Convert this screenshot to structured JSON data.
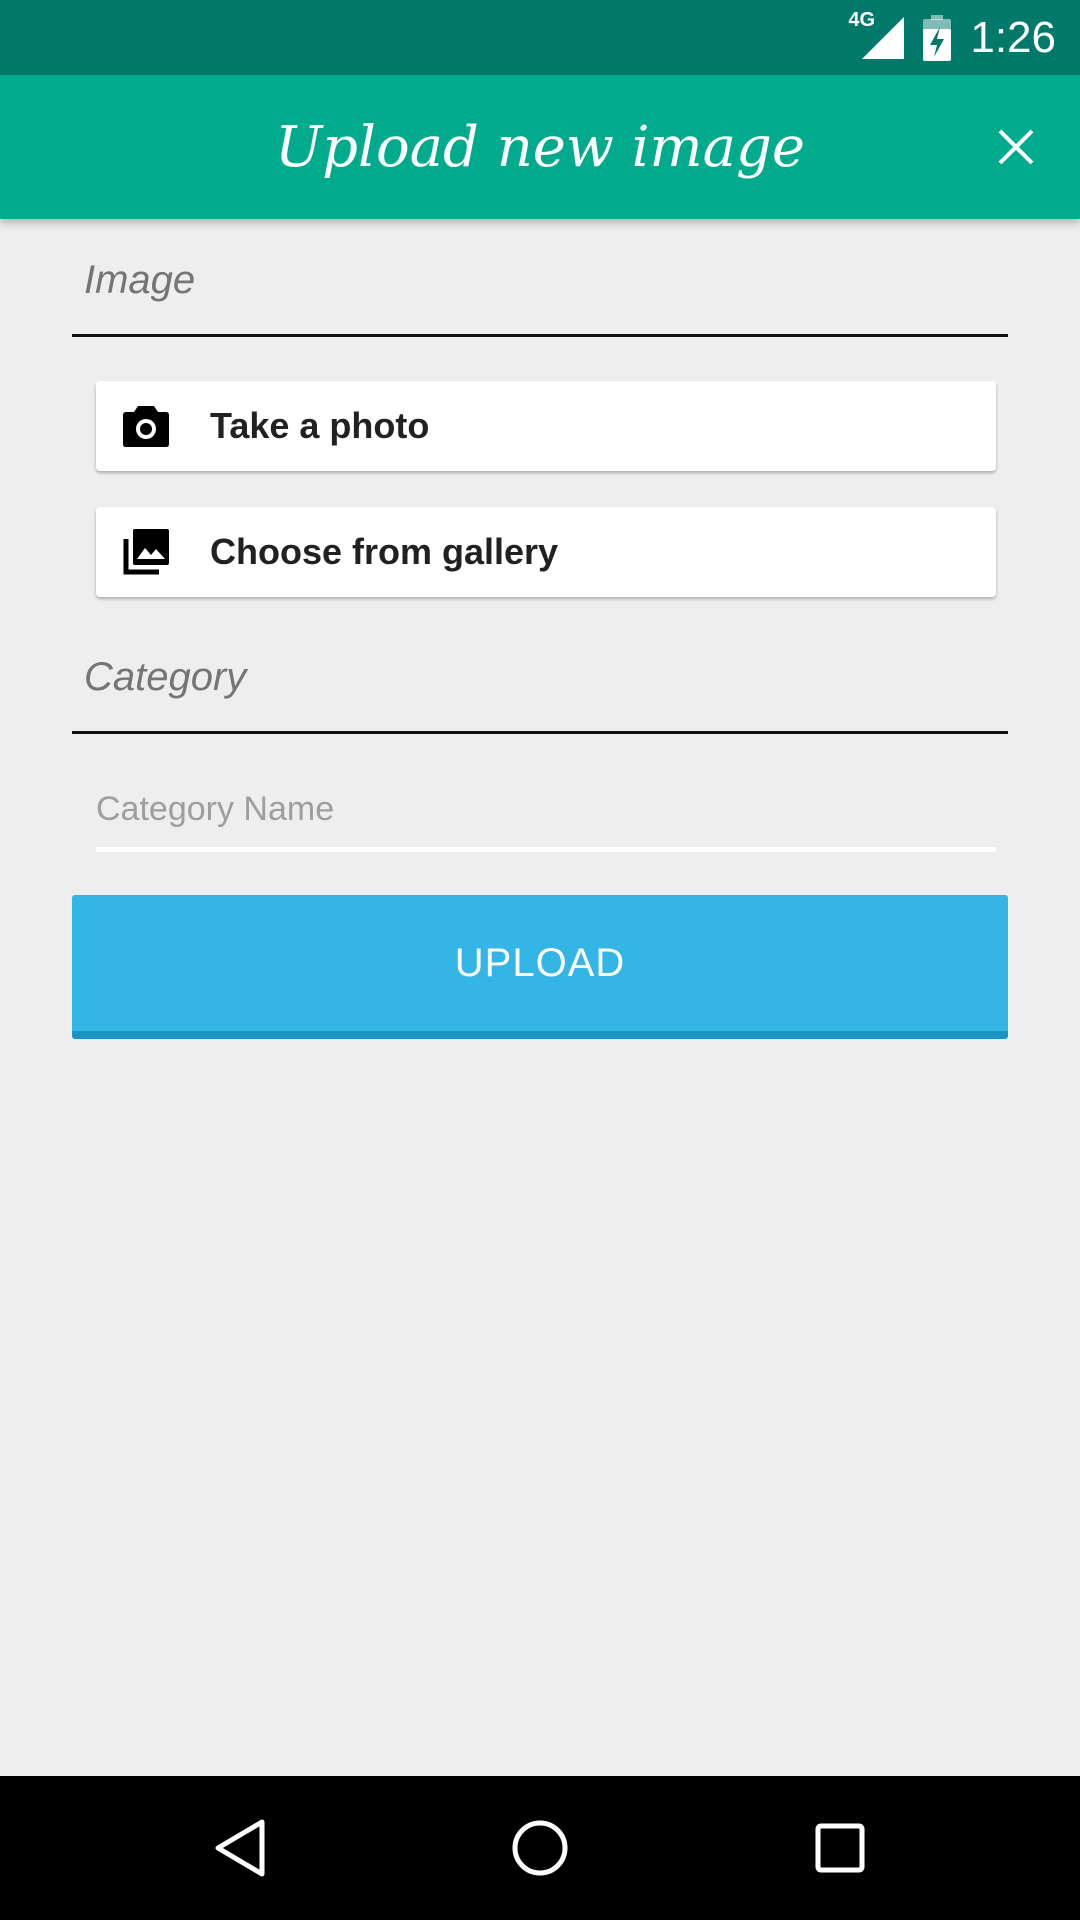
{
  "status_bar": {
    "network": "4G",
    "time": "1:26",
    "icons": [
      "signal-icon",
      "battery-charging-icon"
    ]
  },
  "app_bar": {
    "title": "Upload new image",
    "close_icon": "close-icon"
  },
  "image_section": {
    "label": "Image",
    "take_photo": {
      "label": "Take a photo",
      "icon": "camera-icon"
    },
    "choose_gallery": {
      "label": "Choose from gallery",
      "icon": "photo-library-icon"
    }
  },
  "category_section": {
    "label": "Category",
    "name_input": {
      "placeholder": "Category Name",
      "value": ""
    }
  },
  "upload_button": {
    "label": "UPLOAD"
  },
  "nav_bar": {
    "icons": [
      "back-icon",
      "home-icon",
      "recents-icon"
    ]
  },
  "colors": {
    "status_bar": "#00796b",
    "app_bar": "#00ab8d",
    "upload": "#33b5e5",
    "background": "#eeeeee"
  }
}
